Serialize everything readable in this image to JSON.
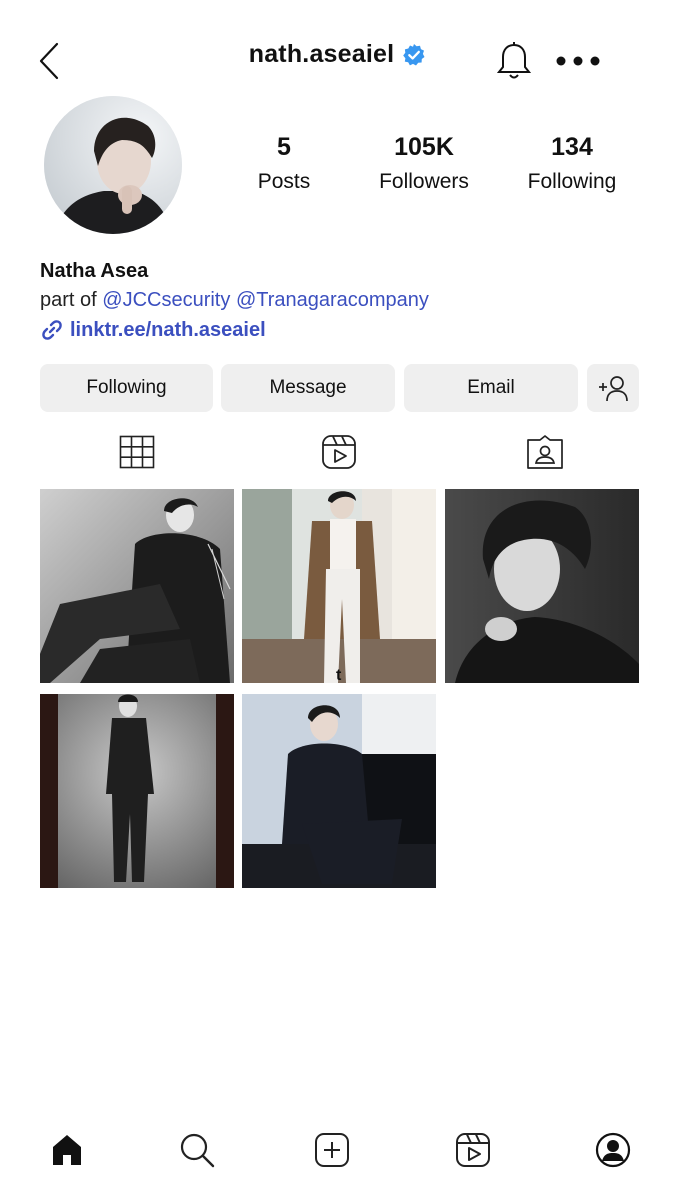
{
  "header": {
    "username": "nath.aseaiel",
    "verified_color": "#3897f0"
  },
  "profile": {
    "stats": [
      {
        "num": "5",
        "label": "Posts"
      },
      {
        "num": "105K",
        "label": "Followers"
      },
      {
        "num": "134",
        "label": "Following"
      }
    ],
    "name": "Natha Asea",
    "bio_prefix": "part of",
    "mentions": [
      "@JCCsecurity",
      "@Tranagaracompany"
    ],
    "link": "linktr.ee/nath.aseaiel",
    "link_color": "#3b4fbf"
  },
  "actions": {
    "following": "Following",
    "message": "Message",
    "email": "Email"
  },
  "tabs": [
    "grid-icon",
    "reels-icon",
    "tagged-icon"
  ],
  "posts": [
    {
      "id": 1,
      "caption": ""
    },
    {
      "id": 2,
      "caption": "t"
    },
    {
      "id": 3,
      "caption": ""
    },
    {
      "id": 4,
      "caption": ""
    },
    {
      "id": 5,
      "caption": ""
    }
  ],
  "bottom_nav": [
    "home-icon",
    "search-icon",
    "create-icon",
    "reels-icon",
    "profile-icon"
  ]
}
